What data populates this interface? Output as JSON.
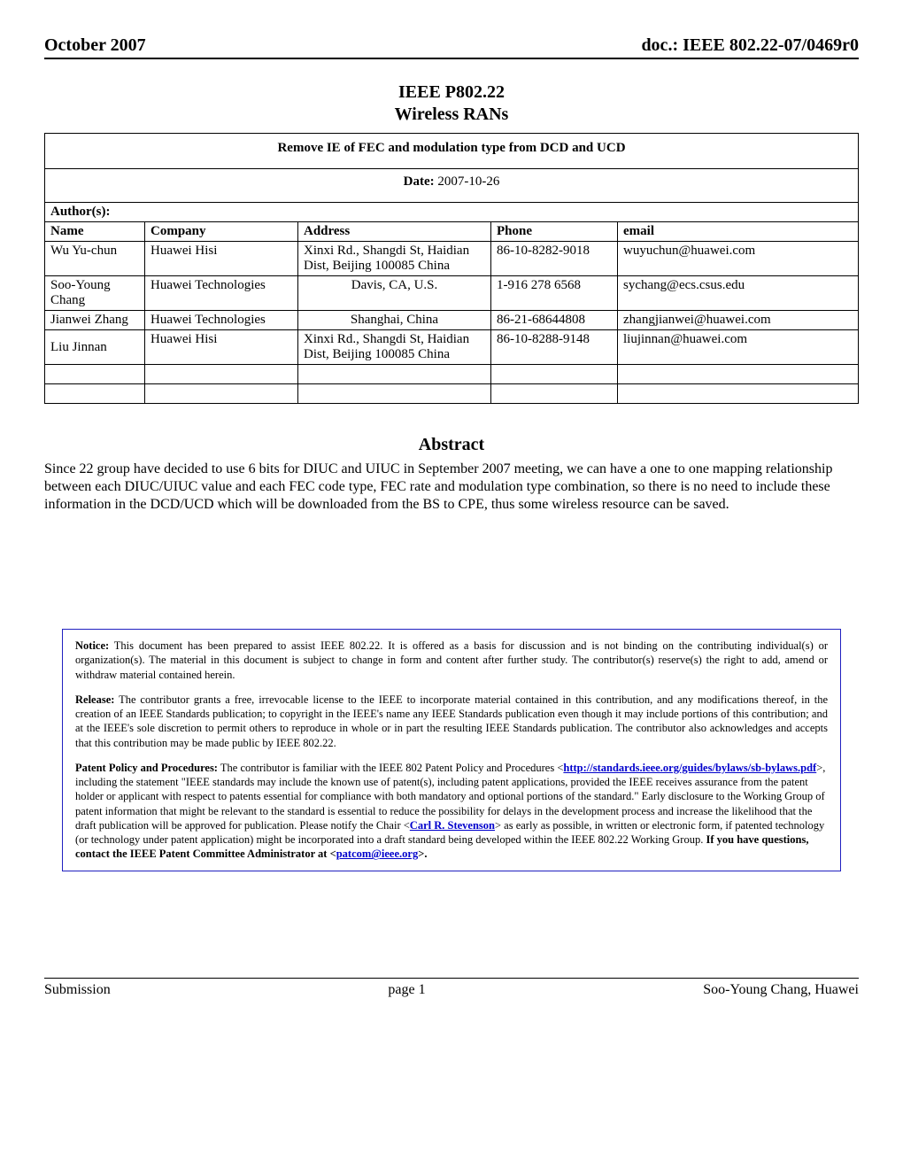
{
  "header": {
    "left": "October 2007",
    "right": "doc.: IEEE 802.22-07/0469r0"
  },
  "heading": {
    "line1": "IEEE P802.22",
    "line2": "Wireless RANs"
  },
  "doc_title": "Remove IE of FEC and modulation type from DCD and UCD",
  "date_label": "Date:",
  "date_value": "2007-10-26",
  "authors_label": "Author(s):",
  "columns": {
    "name": "Name",
    "company": "Company",
    "address": "Address",
    "phone": "Phone",
    "email": "email"
  },
  "authors": [
    {
      "name": "Wu Yu-chun",
      "company": "Huawei Hisi",
      "address": "Xinxi Rd., Shangdi St, Haidian Dist, Beijing 100085 China",
      "phone": "86-10-8282-9018",
      "email": "wuyuchun@huawei.com"
    },
    {
      "name": "Soo-Young Chang",
      "company": "Huawei Technologies",
      "address": "Davis, CA, U.S.",
      "phone": "1-916 278 6568",
      "email": "sychang@ecs.csus.edu"
    },
    {
      "name": "Jianwei Zhang",
      "company": "Huawei Technologies",
      "address": "Shanghai, China",
      "phone": "86-21-68644808",
      "email": "zhangjianwei@huawei.com"
    },
    {
      "name": "Liu Jinnan",
      "company": "Huawei Hisi",
      "address": "Xinxi Rd., Shangdi St, Haidian Dist, Beijing 100085 China",
      "phone": "86-10-8288-9148",
      "email": "liujinnan@huawei.com"
    }
  ],
  "abstract_h": "Abstract",
  "abstract_text": "Since 22 group have decided to use 6 bits for DIUC and UIUC in September 2007 meeting, we can have a one to one mapping relationship between each DIUC/UIUC value and each FEC code type, FEC rate and modulation type combination, so there is no need to include these information in the DCD/UCD which will be downloaded from the BS to CPE,  thus some wireless resource can be saved.",
  "notice": {
    "notice_label": "Notice:",
    "notice_text": " This document has been prepared to assist IEEE 802.22. It is offered as a basis for discussion and is not binding on the contributing individual(s) or organization(s).  The material in this document is subject to change in form and content after further study. The contributor(s) reserve(s) the right to add, amend or withdraw material contained herein.",
    "release_label": "Release:",
    "release_text": " The contributor grants a free, irrevocable license to the IEEE to incorporate material contained in this contribution, and any modifications thereof, in the creation of an IEEE Standards publication; to copyright in the IEEE's name any IEEE Standards publication even though it may include portions of this contribution; and at the IEEE's sole discretion to permit others to reproduce in whole or in part the resulting IEEE Standards publication.  The contributor also acknowledges and accepts that this contribution may be made public by IEEE 802.22.",
    "patent_label": "Patent Policy and Procedures:",
    "patent_pre": " The contributor is familiar with the IEEE 802 Patent Policy and Procedures <",
    "patent_link1": "http://standards.ieee.org/guides/bylaws/sb-bylaws.pdf",
    "patent_mid1": ">, including the statement \"IEEE standards may include the known use of patent(s), including patent applications, provided the IEEE receives assurance from the patent holder or applicant with respect to patents essential for compliance with both mandatory and optional portions of the standard.\"  Early disclosure to the Working Group of patent information that might be relevant to the standard is essential to reduce the possibility for delays in the development process and increase the likelihood that the draft publication will be approved for publication.  Please notify the Chair <",
    "patent_link2": "Carl R. Stevenson",
    "patent_mid2": "> as early as possible, in written or electronic form, if patented technology (or technology under patent application) might be incorporated into a draft standard being developed within the IEEE 802.22 Working Group.  ",
    "patent_bold_tail_pre": "If you have questions, contact the IEEE Patent Committee Administrator at <",
    "patent_link3": "patcom@ieee.org",
    "patent_bold_tail_post": ">."
  },
  "footer": {
    "left": "Submission",
    "center": "page 1",
    "right": "Soo-Young Chang, Huawei"
  }
}
